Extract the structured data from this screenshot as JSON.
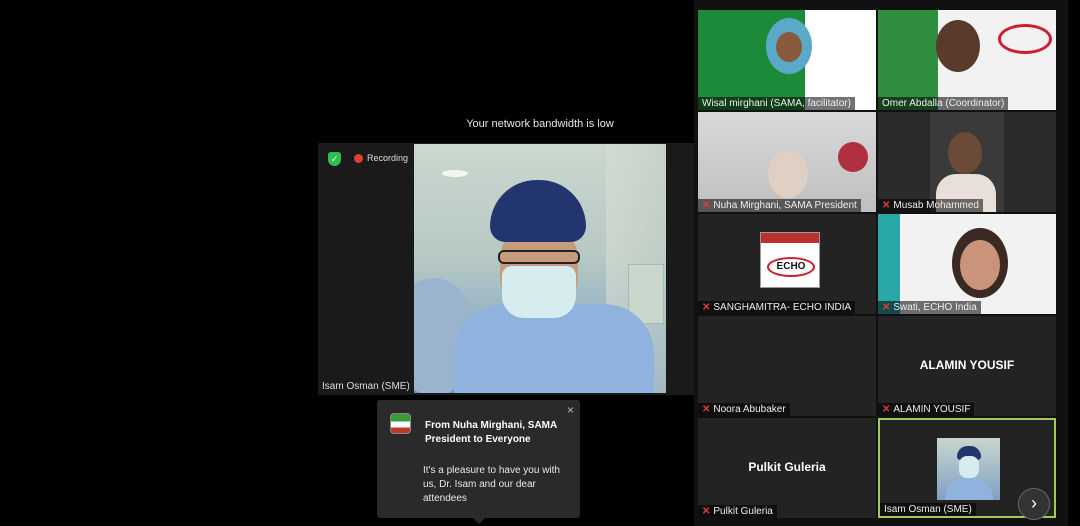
{
  "network_notice": "Your network bandwidth is low",
  "speaker": {
    "recording_label": "Recording",
    "name": "Isam Osman (SME)"
  },
  "chat_toast": {
    "title": "From Nuha Mirghani, SAMA President to Everyone",
    "message": "It's a pleasure to have you with us, Dr. Isam and our dear attendees",
    "close_glyph": "×"
  },
  "gallery": {
    "tiles": [
      {
        "label": "Wisal mirghani (SAMA, facilitator)"
      },
      {
        "label": "Omer Abdalla (Coordinator)"
      },
      {
        "label": "Nuha Mirghani, SAMA President"
      },
      {
        "label": "Musab Mohammed"
      },
      {
        "label": "SANGHAMITRA- ECHO INDIA"
      },
      {
        "label": "Swati, ECHO India"
      },
      {
        "label": "Noora Abubaker"
      },
      {
        "label": "ALAMIN YOUSIF",
        "big": "ALAMIN YOUSIF"
      },
      {
        "label": "Pulkit Guleria",
        "big": "Pulkit Guleria"
      },
      {
        "label": "Isam Osman (SME)"
      }
    ],
    "echo_logo_text": "ECHO",
    "next_glyph": "›"
  }
}
